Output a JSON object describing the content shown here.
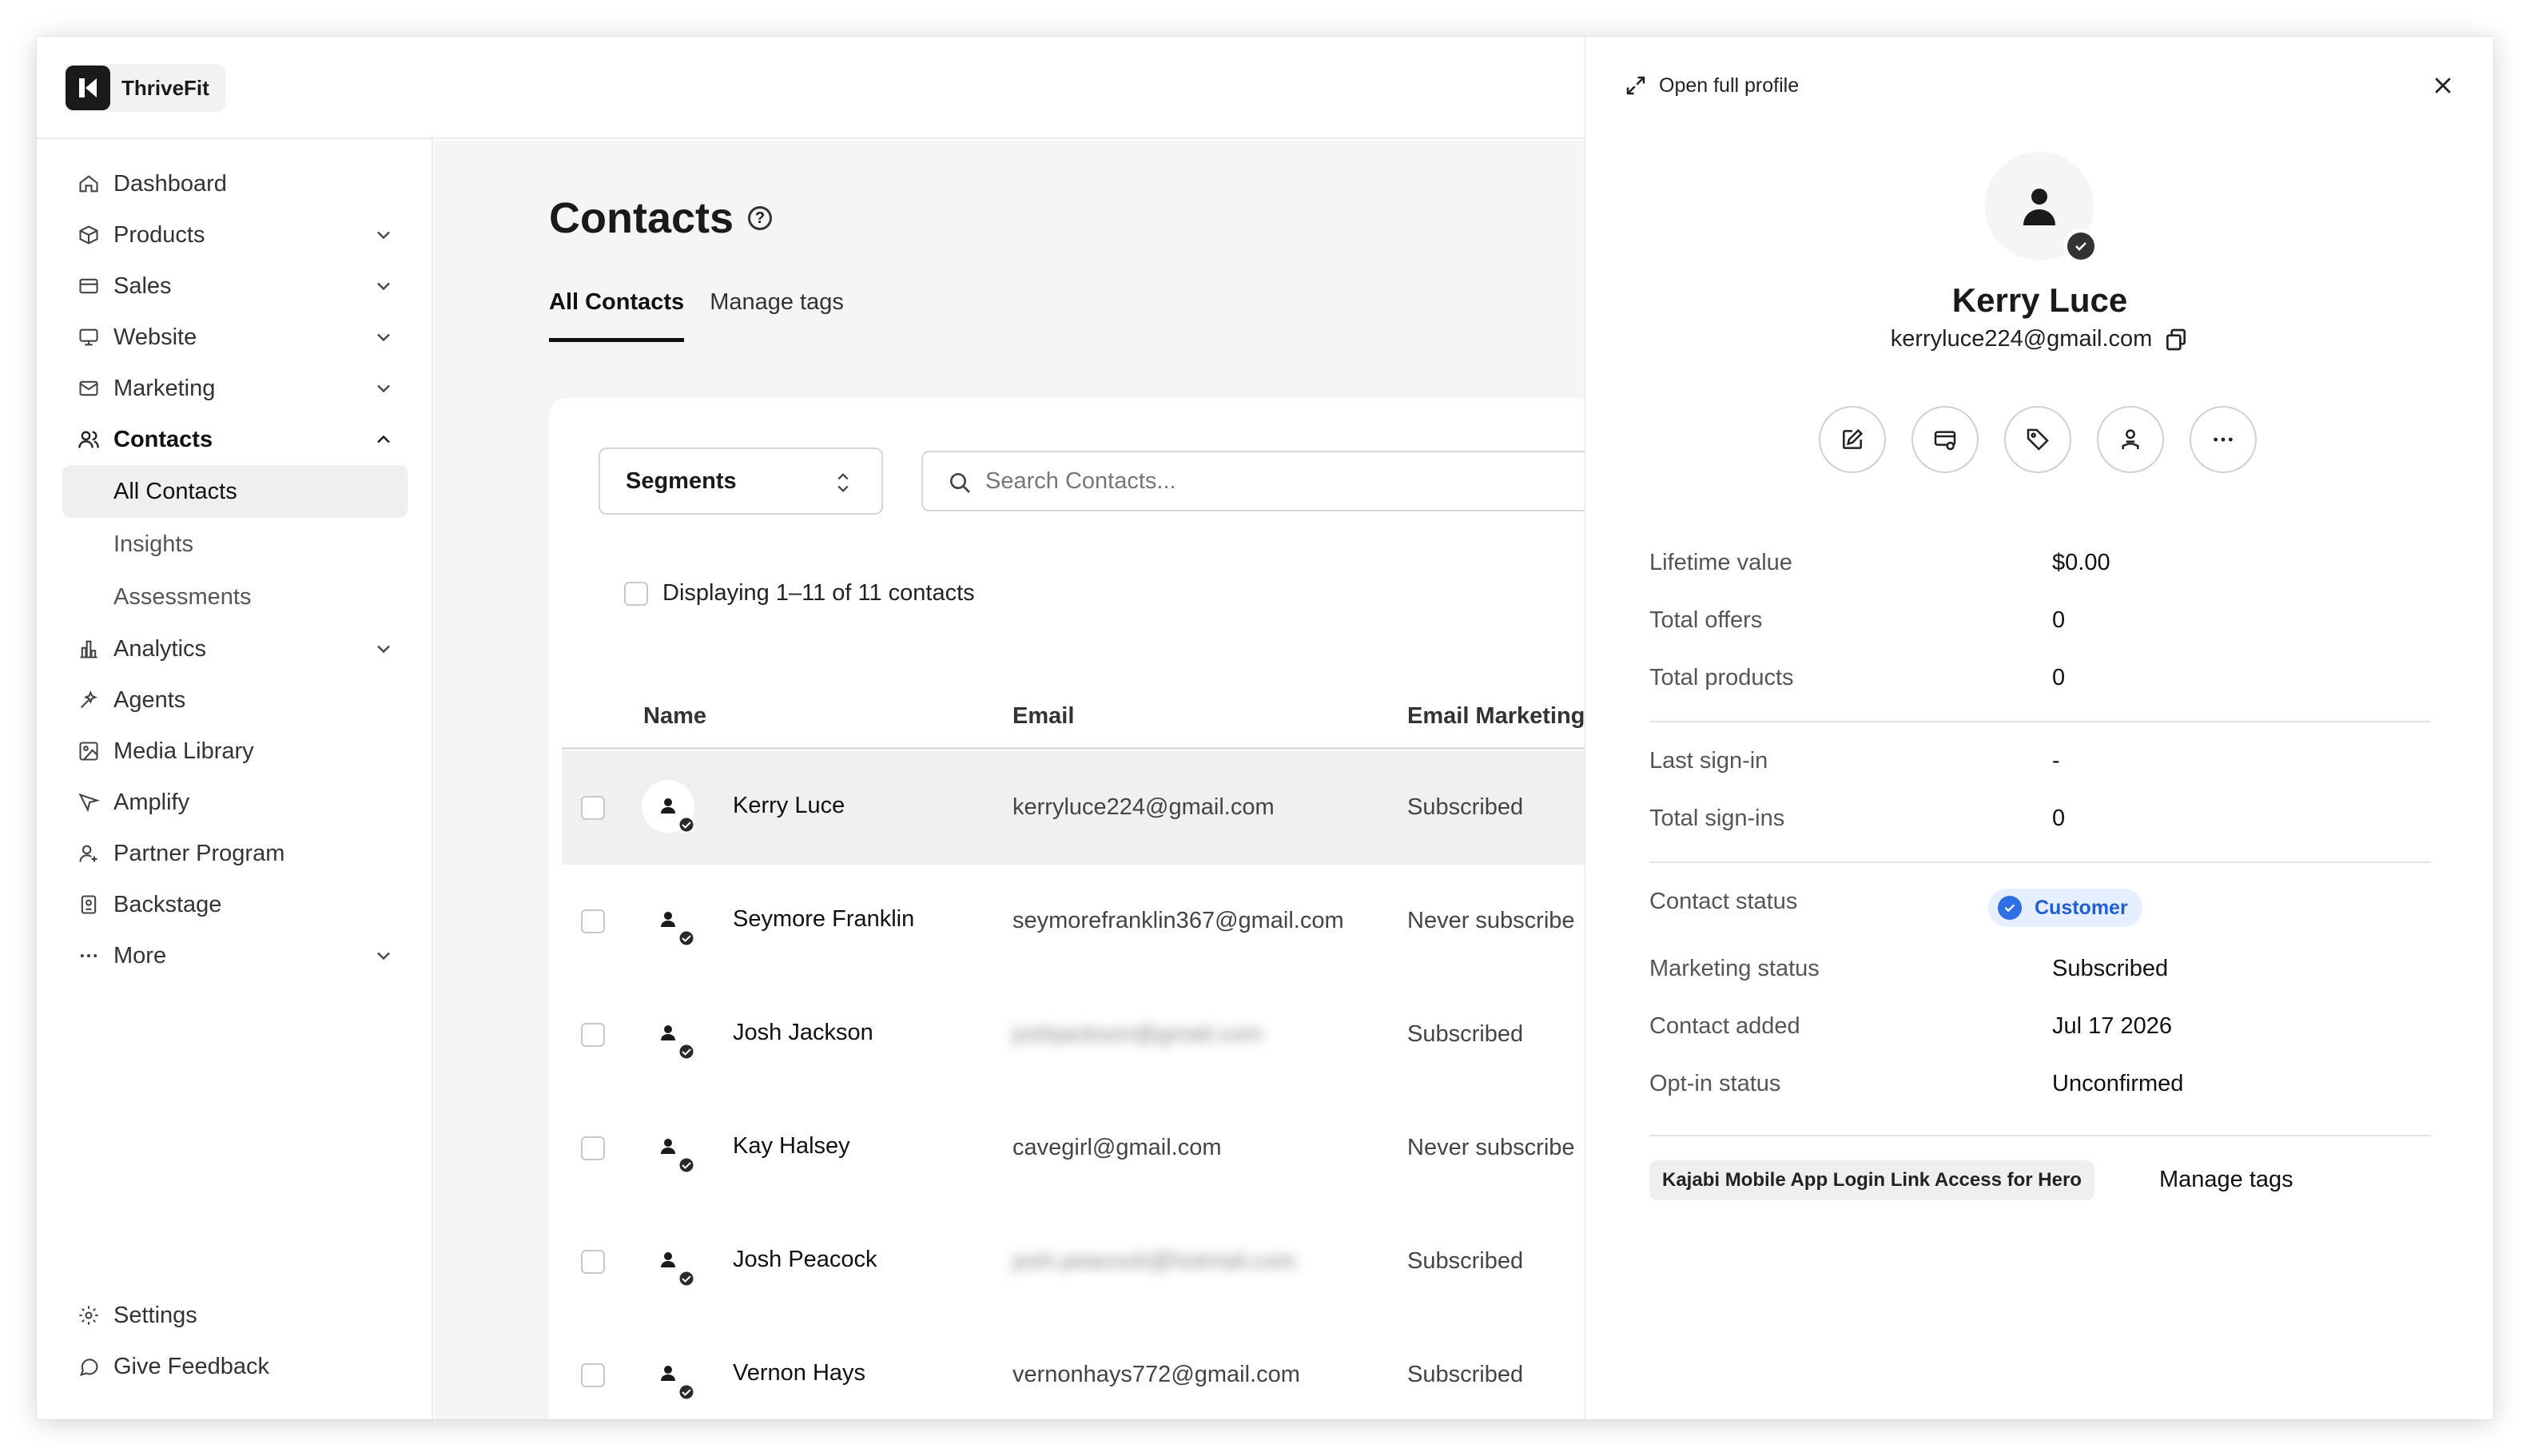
{
  "app": {
    "name": "ThriveFit"
  },
  "sidebar": {
    "items": [
      {
        "label": "Dashboard",
        "icon": "home-icon",
        "expandable": false
      },
      {
        "label": "Products",
        "icon": "box-icon",
        "expandable": true
      },
      {
        "label": "Sales",
        "icon": "card-icon",
        "expandable": true
      },
      {
        "label": "Website",
        "icon": "monitor-icon",
        "expandable": true
      },
      {
        "label": "Marketing",
        "icon": "mail-icon",
        "expandable": true
      },
      {
        "label": "Contacts",
        "icon": "users-icon",
        "expandable": true,
        "expanded": true
      }
    ],
    "sub_items": [
      {
        "label": "All Contacts",
        "active": true
      },
      {
        "label": "Insights",
        "active": false
      },
      {
        "label": "Assessments",
        "active": false
      }
    ],
    "items_after": [
      {
        "label": "Analytics",
        "icon": "bar-chart-icon",
        "expandable": true
      },
      {
        "label": "Agents",
        "icon": "sparkle-icon",
        "expandable": false
      },
      {
        "label": "Media Library",
        "icon": "image-icon",
        "expandable": false
      },
      {
        "label": "Amplify",
        "icon": "megaphone-icon",
        "expandable": false
      },
      {
        "label": "Partner Program",
        "icon": "user-plus-icon",
        "expandable": false
      },
      {
        "label": "Backstage",
        "icon": "backstage-icon",
        "expandable": false
      },
      {
        "label": "More",
        "icon": "dots-icon",
        "expandable": true
      }
    ],
    "bottom": [
      {
        "label": "Settings",
        "icon": "gear-icon"
      },
      {
        "label": "Give Feedback",
        "icon": "chat-icon"
      }
    ]
  },
  "main": {
    "title": "Contacts",
    "tabs": [
      {
        "label": "All Contacts",
        "active": true
      },
      {
        "label": "Manage tags",
        "active": false
      }
    ],
    "segments_label": "Segments",
    "search_placeholder": "Search Contacts...",
    "display_text": "Displaying 1–11 of 11 contacts",
    "columns": [
      "Name",
      "Email",
      "Email Marketing"
    ],
    "rows": [
      {
        "name": "Kerry Luce",
        "email": "kerryluce224@gmail.com",
        "status": "Subscribed",
        "selected": true,
        "blurred": false
      },
      {
        "name": "Seymore Franklin",
        "email": "seymorefranklin367@gmail.com",
        "status": "Never subscribe",
        "selected": false,
        "blurred": false
      },
      {
        "name": "Josh Jackson",
        "email": "joshjackson@gmail.com",
        "status": "Subscribed",
        "selected": false,
        "blurred": true
      },
      {
        "name": "Kay Halsey",
        "email": "cavegirl@gmail.com",
        "status": "Never subscribe",
        "selected": false,
        "blurred": false
      },
      {
        "name": "Josh Peacock",
        "email": "josh.peacock@hotmail.com",
        "status": "Subscribed",
        "selected": false,
        "blurred": true
      },
      {
        "name": "Vernon Hays",
        "email": "vernonhays772@gmail.com",
        "status": "Subscribed",
        "selected": false,
        "blurred": false
      }
    ]
  },
  "panel": {
    "open_full_label": "Open full profile",
    "name": "Kerry Luce",
    "email": "kerryluce224@gmail.com",
    "actions": [
      "edit-icon",
      "billing-icon",
      "tag-icon",
      "assign-icon",
      "more-icon"
    ],
    "stats": [
      {
        "label": "Lifetime value",
        "value": "$0.00"
      },
      {
        "label": "Total offers",
        "value": "0"
      },
      {
        "label": "Total products",
        "value": "0"
      }
    ],
    "signins": [
      {
        "label": "Last sign-in",
        "value": "-"
      },
      {
        "label": "Total sign-ins",
        "value": "0"
      }
    ],
    "contact_status_label": "Contact status",
    "contact_status_value": "Customer",
    "details": [
      {
        "label": "Marketing status",
        "value": "Subscribed"
      },
      {
        "label": "Contact added",
        "value": "Jul 17 2026"
      },
      {
        "label": "Opt-in status",
        "value": "Unconfirmed"
      }
    ],
    "tag": "Kajabi Mobile App Login Link Access for Hero",
    "manage_tags_label": "Manage tags"
  },
  "colors": {
    "accent_blue": "#2f6fe4",
    "badge_bg": "#e6efff",
    "dark": "#1a1a1a"
  }
}
